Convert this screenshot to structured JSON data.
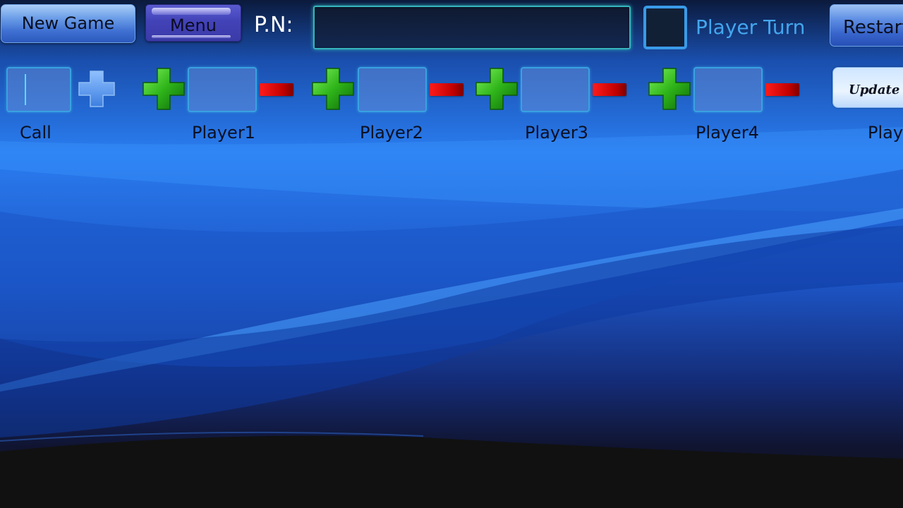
{
  "toolbar": {
    "new_game_label": "New Game",
    "menu_label": "Menu",
    "pn_label": "P.N:",
    "pn_value": "",
    "player_turn_label": "Player Turn",
    "player_turn_checked": false,
    "restart_label": "Restart"
  },
  "scoreboard": {
    "call": {
      "label": "Call",
      "value": ""
    },
    "players": [
      {
        "label": "Player1",
        "value": ""
      },
      {
        "label": "Player2",
        "value": ""
      },
      {
        "label": "Player3",
        "value": ""
      },
      {
        "label": "Player4",
        "value": ""
      }
    ],
    "update_label": "Update",
    "extra_label": "Play"
  },
  "icons": {
    "call_increment": "plus-icon",
    "player_increment": "plus-icon",
    "player_decrement": "minus-icon"
  },
  "colors": {
    "accent_cyan": "#36b5bd",
    "turn_blue": "#43a6ee",
    "plus_green": "#3fbf1f",
    "minus_red": "#d00000"
  }
}
